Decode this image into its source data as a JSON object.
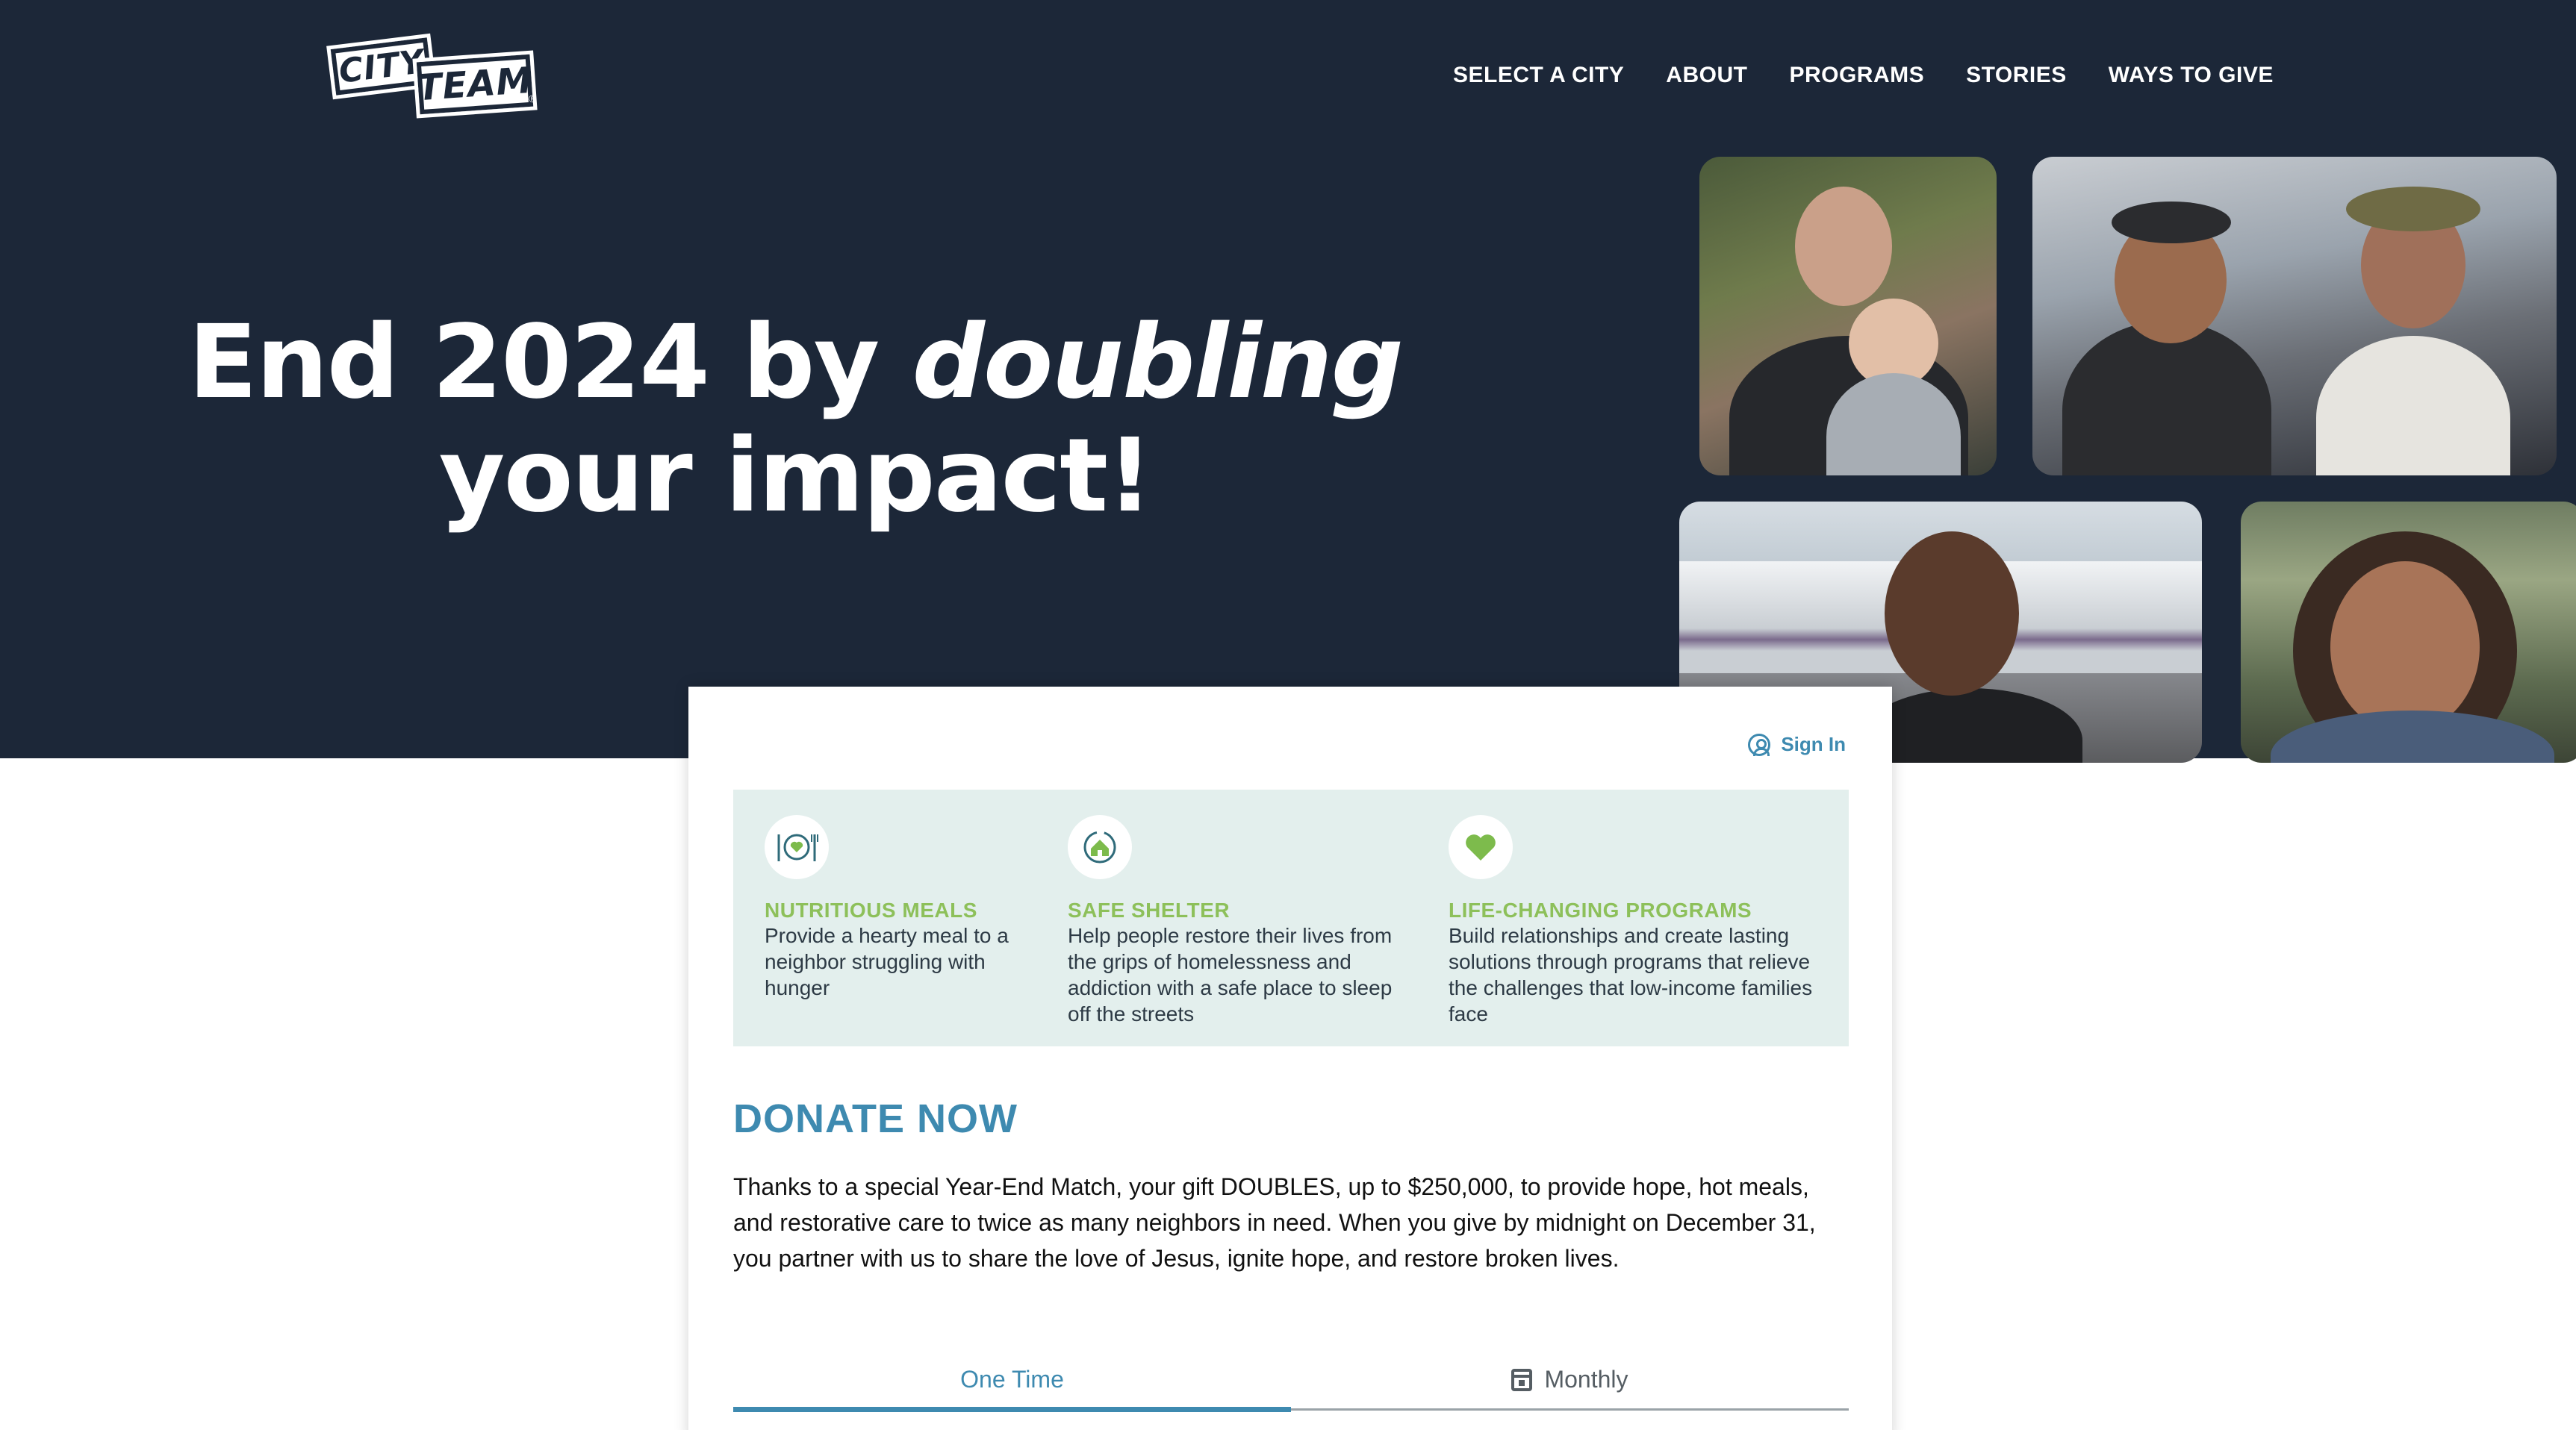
{
  "brand": {
    "logo_top": "CITY",
    "logo_bottom": "TEAM",
    "logo_mark": "®"
  },
  "nav": {
    "items": [
      "SELECT A CITY",
      "ABOUT",
      "PROGRAMS",
      "STORIES",
      "WAYS TO GIVE"
    ]
  },
  "hero": {
    "line1_prefix": "End 2024 by ",
    "line1_emphasis": "doubling",
    "line2": "your impact!"
  },
  "donation_card": {
    "sign_in": "Sign In",
    "benefits": [
      {
        "icon": "meal-icon",
        "title": "NUTRITIOUS MEALS",
        "text": "Provide a hearty meal to a neighbor struggling with hunger"
      },
      {
        "icon": "shelter-icon",
        "title": "SAFE SHELTER",
        "text": "Help people restore their lives from the grips of homelessness and addiction with a safe place to sleep off the streets"
      },
      {
        "icon": "heart-icon",
        "title": "LIFE-CHANGING PROGRAMS",
        "text": "Build relationships and create lasting solutions through programs that relieve the challenges that low-income families face"
      }
    ],
    "title": "DONATE NOW",
    "description": "Thanks to a special Year-End Match, your gift DOUBLES, up to $250,000, to provide hope, hot meals, and restorative care to twice as many neighbors in need. When you give by midnight on December 31, you partner with us to share the love of Jesus, ignite hope, and restore broken lives.",
    "tabs": [
      {
        "label": "One Time",
        "active": true
      },
      {
        "label": "Monthly",
        "active": false,
        "icon": "calendar-icon"
      }
    ]
  },
  "colors": {
    "hero_bg": "#1c2738",
    "accent_blue": "#3e8ab0",
    "accent_green": "#8dc05a",
    "benefit_bg": "#e3efed"
  }
}
